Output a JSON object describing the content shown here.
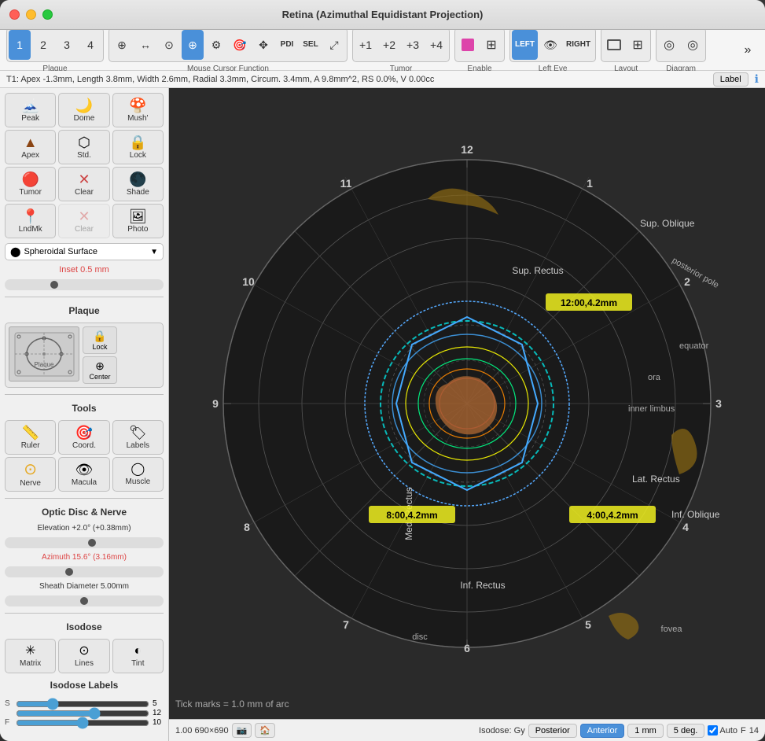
{
  "window": {
    "title": "Retina (Azimuthal Equidistant Projection)"
  },
  "toolbar": {
    "num_buttons": [
      "1",
      "2",
      "3",
      "4"
    ],
    "plaque_label": "Plaque",
    "mouse_label": "Mouse Cursor Function",
    "tumor_label": "Tumor",
    "enable_label": "Enable",
    "left_eye_label": "Left Eye",
    "layout_label": "Layout",
    "diagram_label": "Diagram",
    "left_btn": "LEFT",
    "right_btn": "RIGHT",
    "plus1": "+1",
    "plus2": "+2",
    "plus3": "+3",
    "plus4": "+4"
  },
  "status_bar": {
    "text": "T1: Apex -1.3mm, Length 3.8mm, Width 2.6mm, Radial 3.3mm, Circum. 3.4mm, A 9.8mm^2, RS 0.0%, V 0.00cc",
    "label_btn": "Label",
    "info_icon": "ℹ"
  },
  "sidebar": {
    "shape_tools": [
      {
        "label": "Peak",
        "icon": "🗻"
      },
      {
        "label": "Dome",
        "icon": "🌙"
      },
      {
        "label": "Mush'",
        "icon": "🍄"
      },
      {
        "label": "Apex",
        "icon": "▲"
      },
      {
        "label": "Std.",
        "icon": "⬡"
      },
      {
        "label": "Lock",
        "icon": "🔒"
      },
      {
        "label": "Tumor",
        "icon": "🔴"
      },
      {
        "label": "Clear",
        "icon": "✕"
      },
      {
        "label": "Shade",
        "icon": "⬡"
      },
      {
        "label": "LndMk",
        "icon": "📍"
      },
      {
        "label": "Clear",
        "icon": "✕"
      },
      {
        "label": "Photo",
        "icon": "📷"
      }
    ],
    "surface_label": "Spheroidal Surface",
    "inset_label": "Inset 0.5 mm",
    "plaque_section_label": "Plaque",
    "plaque_center_label": "Center",
    "plaque_lock_label": "Lock",
    "tools_section_label": "Tools",
    "tool_items": [
      {
        "label": "Ruler",
        "icon": "📏"
      },
      {
        "label": "Coord.",
        "icon": "🎯"
      },
      {
        "label": "Labels",
        "icon": "🏷"
      },
      {
        "label": "Nerve",
        "icon": "⭕"
      },
      {
        "label": "Macula",
        "icon": "👁"
      },
      {
        "label": "Muscle",
        "icon": "⭕"
      }
    ],
    "optic_disc_label": "Optic Disc & Nerve",
    "elevation_label": "Elevation +2.0° (+0.38mm)",
    "azimuth_label": "Azimuth 15.6° (3.16mm)",
    "sheath_label": "Sheath Diameter 5.00mm",
    "isodose_label": "Isodose",
    "isodose_items": [
      {
        "label": "Matrix",
        "icon": "✳"
      },
      {
        "label": "Lines",
        "icon": "⊙"
      },
      {
        "label": "Tint",
        "icon": "◐"
      }
    ],
    "isodose_labels_title": "Isodose Labels",
    "iso_s_label": "S",
    "iso_s_value": "5",
    "iso_mid_value": "12",
    "iso_f_label": "F",
    "iso_f_value": "10"
  },
  "canvas": {
    "clock_labels": [
      "12",
      "1",
      "2",
      "3",
      "4",
      "5",
      "6",
      "7",
      "8",
      "9",
      "10",
      "11"
    ],
    "circle_labels": [
      "posterior pole",
      "equator",
      "ora",
      "inner limbus",
      "Lat. Rectus",
      "Med. Rectus",
      "Sup. Rectus",
      "Inf. Rectus",
      "Sup. Oblique",
      "Inf. Oblique",
      "disc",
      "fovea"
    ],
    "tumor_labels": [
      "12:00,4.2mm",
      "8:00,4.2mm",
      "4:00,4.2mm"
    ],
    "tick_label": "Tick marks = 1.0 mm of arc"
  },
  "footer": {
    "zoom": "1.00",
    "size": "690×690",
    "posterior_btn": "Posterior",
    "anterior_btn": "Anterior",
    "spacing_btn": "1 mm",
    "deg_btn": "5 deg.",
    "auto_label": "Auto",
    "f_label": "F",
    "page_num": "14",
    "isodose_label": "Isodose: Gy"
  }
}
